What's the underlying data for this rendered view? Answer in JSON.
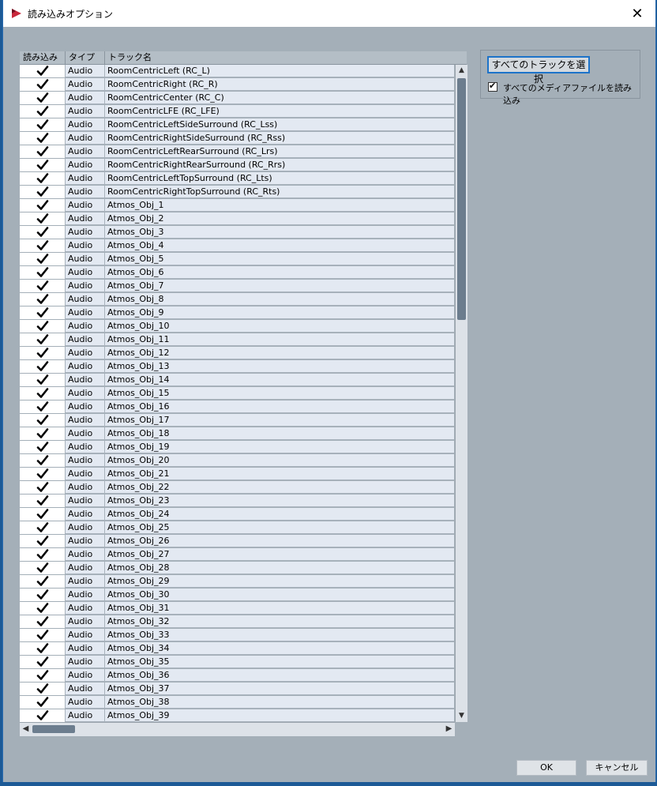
{
  "window": {
    "title": "読み込みオプション",
    "close_glyph": "✕"
  },
  "table": {
    "headers": {
      "import": "読み込み",
      "type": "タイプ",
      "track_name": "トラック名"
    },
    "rows": [
      {
        "type": "Audio",
        "name": "RoomCentricLeft (RC_L)",
        "checked": true
      },
      {
        "type": "Audio",
        "name": "RoomCentricRight (RC_R)",
        "checked": true
      },
      {
        "type": "Audio",
        "name": "RoomCentricCenter (RC_C)",
        "checked": true
      },
      {
        "type": "Audio",
        "name": "RoomCentricLFE (RC_LFE)",
        "checked": true
      },
      {
        "type": "Audio",
        "name": "RoomCentricLeftSideSurround (RC_Lss)",
        "checked": true
      },
      {
        "type": "Audio",
        "name": "RoomCentricRightSideSurround (RC_Rss)",
        "checked": true
      },
      {
        "type": "Audio",
        "name": "RoomCentricLeftRearSurround (RC_Lrs)",
        "checked": true
      },
      {
        "type": "Audio",
        "name": "RoomCentricRightRearSurround (RC_Rrs)",
        "checked": true
      },
      {
        "type": "Audio",
        "name": "RoomCentricLeftTopSurround (RC_Lts)",
        "checked": true
      },
      {
        "type": "Audio",
        "name": "RoomCentricRightTopSurround (RC_Rts)",
        "checked": true
      },
      {
        "type": "Audio",
        "name": "Atmos_Obj_1",
        "checked": true
      },
      {
        "type": "Audio",
        "name": "Atmos_Obj_2",
        "checked": true
      },
      {
        "type": "Audio",
        "name": "Atmos_Obj_3",
        "checked": true
      },
      {
        "type": "Audio",
        "name": "Atmos_Obj_4",
        "checked": true
      },
      {
        "type": "Audio",
        "name": "Atmos_Obj_5",
        "checked": true
      },
      {
        "type": "Audio",
        "name": "Atmos_Obj_6",
        "checked": true
      },
      {
        "type": "Audio",
        "name": "Atmos_Obj_7",
        "checked": true
      },
      {
        "type": "Audio",
        "name": "Atmos_Obj_8",
        "checked": true
      },
      {
        "type": "Audio",
        "name": "Atmos_Obj_9",
        "checked": true
      },
      {
        "type": "Audio",
        "name": "Atmos_Obj_10",
        "checked": true
      },
      {
        "type": "Audio",
        "name": "Atmos_Obj_11",
        "checked": true
      },
      {
        "type": "Audio",
        "name": "Atmos_Obj_12",
        "checked": true
      },
      {
        "type": "Audio",
        "name": "Atmos_Obj_13",
        "checked": true
      },
      {
        "type": "Audio",
        "name": "Atmos_Obj_14",
        "checked": true
      },
      {
        "type": "Audio",
        "name": "Atmos_Obj_15",
        "checked": true
      },
      {
        "type": "Audio",
        "name": "Atmos_Obj_16",
        "checked": true
      },
      {
        "type": "Audio",
        "name": "Atmos_Obj_17",
        "checked": true
      },
      {
        "type": "Audio",
        "name": "Atmos_Obj_18",
        "checked": true
      },
      {
        "type": "Audio",
        "name": "Atmos_Obj_19",
        "checked": true
      },
      {
        "type": "Audio",
        "name": "Atmos_Obj_20",
        "checked": true
      },
      {
        "type": "Audio",
        "name": "Atmos_Obj_21",
        "checked": true
      },
      {
        "type": "Audio",
        "name": "Atmos_Obj_22",
        "checked": true
      },
      {
        "type": "Audio",
        "name": "Atmos_Obj_23",
        "checked": true
      },
      {
        "type": "Audio",
        "name": "Atmos_Obj_24",
        "checked": true
      },
      {
        "type": "Audio",
        "name": "Atmos_Obj_25",
        "checked": true
      },
      {
        "type": "Audio",
        "name": "Atmos_Obj_26",
        "checked": true
      },
      {
        "type": "Audio",
        "name": "Atmos_Obj_27",
        "checked": true
      },
      {
        "type": "Audio",
        "name": "Atmos_Obj_28",
        "checked": true
      },
      {
        "type": "Audio",
        "name": "Atmos_Obj_29",
        "checked": true
      },
      {
        "type": "Audio",
        "name": "Atmos_Obj_30",
        "checked": true
      },
      {
        "type": "Audio",
        "name": "Atmos_Obj_31",
        "checked": true
      },
      {
        "type": "Audio",
        "name": "Atmos_Obj_32",
        "checked": true
      },
      {
        "type": "Audio",
        "name": "Atmos_Obj_33",
        "checked": true
      },
      {
        "type": "Audio",
        "name": "Atmos_Obj_34",
        "checked": true
      },
      {
        "type": "Audio",
        "name": "Atmos_Obj_35",
        "checked": true
      },
      {
        "type": "Audio",
        "name": "Atmos_Obj_36",
        "checked": true
      },
      {
        "type": "Audio",
        "name": "Atmos_Obj_37",
        "checked": true
      },
      {
        "type": "Audio",
        "name": "Atmos_Obj_38",
        "checked": true
      },
      {
        "type": "Audio",
        "name": "Atmos_Obj_39",
        "checked": true
      }
    ]
  },
  "options": {
    "select_all_label": "すべてのトラックを選択",
    "import_all_media_label": "すべてのメディアファイルを読み込み",
    "import_all_media_checked": true
  },
  "footer": {
    "ok_label": "OK",
    "cancel_label": "キャンセル"
  },
  "colors": {
    "dialog_bg": "#a4afb8",
    "row_bg": "#e3e9f2",
    "accent": "#1d73c9",
    "app_icon": "#c8283c"
  },
  "icons": {
    "app": "app-logo-icon",
    "check": "check-icon",
    "close": "close-icon"
  }
}
